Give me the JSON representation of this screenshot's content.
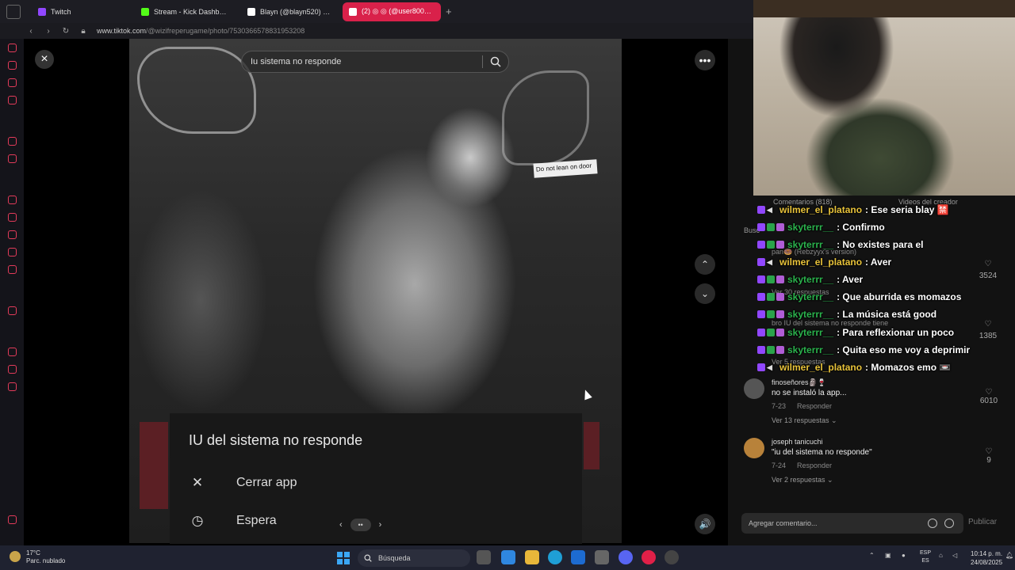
{
  "browser": {
    "tabs": [
      {
        "label": "Twitch",
        "color": "#9147ff",
        "active": false
      },
      {
        "label": "Stream - Kick Dashboard",
        "color": "#53fc18",
        "active": false
      },
      {
        "label": "Blayn (@blayn520) | TikTok",
        "color": "#ffffff",
        "active": false
      },
      {
        "label": "(2) ◎ ◎ (@user8007…",
        "color": "#ffffff",
        "active": true
      }
    ],
    "new_tab": "+",
    "url_host": "www.tiktok.com",
    "url_path": "/@wizifreperugame/photo/7530366578831953208"
  },
  "viewer": {
    "search_query": "Iu sistema no responde",
    "close_icon": "×",
    "more_icon": "•••",
    "up_icon": "⌃",
    "down_icon": "⌄",
    "volume_icon": "🔊",
    "sign_text": "Do not lean on door",
    "pager_prev": "‹",
    "pager_dots": "••",
    "pager_next": "›"
  },
  "dialog": {
    "title": "IU del sistema no responde",
    "options": [
      {
        "icon": "✕",
        "label": "Cerrar app"
      },
      {
        "icon": "◷",
        "label": "Espera"
      }
    ]
  },
  "panel": {
    "tab_comments": "Comentarios (818)",
    "tab_videos": "Videos del creador",
    "search_label": "Busc"
  },
  "chat": [
    {
      "user": "wilmer_el_platano",
      "color": "#e8c33a",
      "msg": "Ese seria blay 🈲",
      "badges": [
        "purple",
        "mute"
      ]
    },
    {
      "user": "skyterrr__",
      "color": "#2bb34d",
      "msg": "Confirmo",
      "badges": [
        "purple",
        "green",
        "sub"
      ]
    },
    {
      "user": "skyterrr__",
      "color": "#2bb34d",
      "msg": "No existes para el",
      "badges": [
        "purple",
        "green",
        "sub"
      ]
    },
    {
      "user": "wilmer_el_platano",
      "color": "#e8c33a",
      "msg": "Aver",
      "badges": [
        "purple",
        "mute"
      ]
    },
    {
      "user": "skyterrr__",
      "color": "#2bb34d",
      "msg": "Aver",
      "badges": [
        "purple",
        "green",
        "sub"
      ]
    },
    {
      "user": "skyterrr__",
      "color": "#2bb34d",
      "msg": "Que aburrida es momazos",
      "badges": [
        "purple",
        "green",
        "sub"
      ]
    },
    {
      "user": "skyterrr__",
      "color": "#2bb34d",
      "msg": "La música está good",
      "badges": [
        "purple",
        "green",
        "sub"
      ]
    },
    {
      "user": "skyterrr__",
      "color": "#2bb34d",
      "msg": "Para reflexionar un poco",
      "badges": [
        "purple",
        "green",
        "sub"
      ]
    },
    {
      "user": "skyterrr__",
      "color": "#2bb34d",
      "msg": "Quita eso me voy a deprimir",
      "badges": [
        "purple",
        "green",
        "sub"
      ]
    },
    {
      "user": "wilmer_el_platano",
      "color": "#e8c33a",
      "msg": "Momazos emo 📼",
      "badges": [
        "purple",
        "mute"
      ]
    }
  ],
  "ghost": {
    "rebzyyx": "pan🍩 (Rebzyyx's version)",
    "ver30": "Ver 30 respuestas",
    "bro": "bro IU del sistema no responde tiene",
    "ver5": "Ver 5 respuestas"
  },
  "side_counts": [
    "3524",
    "1385"
  ],
  "comments": [
    {
      "name": "finoseñores🗿🍷",
      "text": "no se instaló la app...",
      "date": "7-23",
      "reply": "Responder",
      "replies": "Ver 13 respuestas ⌄",
      "likes": "6010"
    },
    {
      "name": "joseph tanicuchi",
      "text": "\"iu del sistema no responde\"",
      "date": "7-24",
      "reply": "Responder",
      "replies": "Ver 2 respuestas ⌄",
      "likes": "9"
    }
  ],
  "composer": {
    "placeholder": "Agregar comentario...",
    "publish": "Publicar"
  },
  "taskbar": {
    "temp": "17°C",
    "weather": "Parc. nublado",
    "search": "Búsqueda",
    "lang_top": "ESP",
    "lang_bottom": "ES",
    "time": "10:14 p. m.",
    "date": "24/08/2025"
  }
}
